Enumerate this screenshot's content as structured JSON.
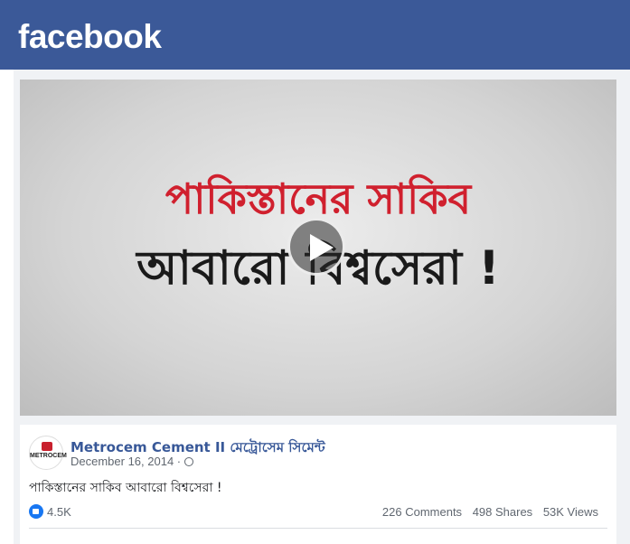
{
  "header": {
    "logo": "facebook"
  },
  "video": {
    "headline_line1": "পাকিস্তানের সাকিব",
    "headline_line2": "আবারো বিশ্বসেরা !",
    "play_icon": "play-icon"
  },
  "post": {
    "page_name": "Metrocem Cement II মেট্রোসেম সিমেন্ট",
    "avatar_text": "METROCEM",
    "date": "December 16, 2014 ·",
    "privacy_icon": "globe-icon",
    "text": "পাকিস্তানের সাকিব আবারো বিশ্বসেরা !",
    "likes": "4.5K",
    "comments": "226 Comments",
    "shares": "498 Shares",
    "views": "53K Views"
  },
  "colors": {
    "brand": "#3b5998",
    "link": "#385898",
    "headline_red": "#d0202e",
    "like_blue": "#1877f2"
  }
}
